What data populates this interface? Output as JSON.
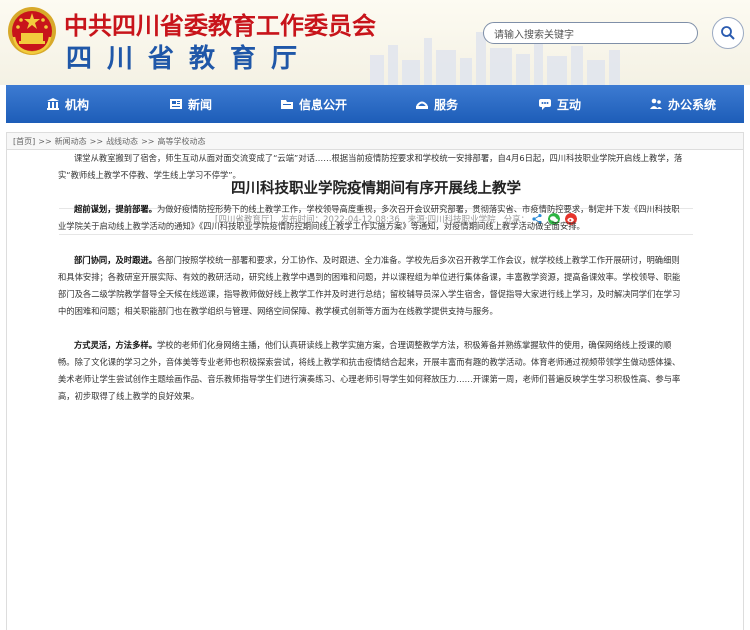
{
  "header": {
    "title": "中共四川省委教育工作委员会",
    "subtitle": "四川省教育厅",
    "search_placeholder": "请输入搜索关键字"
  },
  "nav": {
    "items": [
      {
        "label": "机构",
        "icon": "building-icon"
      },
      {
        "label": "新闻",
        "icon": "newspaper-icon"
      },
      {
        "label": "信息公开",
        "icon": "folder-icon"
      },
      {
        "label": "服务",
        "icon": "service-icon"
      },
      {
        "label": "互动",
        "icon": "chat-icon"
      },
      {
        "label": "办公系统",
        "icon": "people-icon"
      }
    ]
  },
  "breadcrumb": [
    "[首页]",
    ">>",
    "新闻动态",
    ">>",
    "战线动态",
    ">>",
    "高等学校动态"
  ],
  "article": {
    "title": "四川科技职业学院疫情期间有序开展线上教学",
    "meta": {
      "source_org": "[四川省教育厅]",
      "published": "发布时间：2022-04-12 08:36",
      "origin": "来源:四川科技职业学院",
      "share_label": "分享："
    },
    "paragraphs": [
      {
        "lead": "",
        "text": "课堂从教室搬到了宿舍，师生互动从面对面交流变成了“云端”对话……根据当前疫情防控要求和学校统一安排部署，自4月6日起，四川科技职业学院开启线上教学，落实“教师线上教学不停教、学生线上学习不停学”。"
      },
      {
        "lead": "超前谋划，提前部署。",
        "text": "为做好疫情防控形势下的线上教学工作，学校领导高度重视，多次召开会议研究部署，贯彻落实省、市疫情防控要求，制定并下发《四川科技职业学院关于启动线上教学活动的通知》《四川科技职业学院疫情防控期间线上教学工作实施方案》等通知，对疫情期间线上教学活动做全面安排。"
      },
      {
        "lead": "部门协同，及时跟进。",
        "text": "各部门按照学校统一部署和要求，分工协作、及时跟进、全力准备。学校先后多次召开教学工作会议，就学校线上教学工作开展研讨，明确细则和具体安排；各教研室开展实际、有效的教研活动，研究线上教学中遇到的困难和问题，并以课程组为单位进行集体备课，丰富教学资源，提高备课效率。学校领导、职能部门及各二级学院教学督导全天候在线巡课，指导教师做好线上教学工作并及时进行总结；留校辅导员深入学生宿舍，督促指导大家进行线上学习，及时解决同学们在学习中的困难和问题；相关职能部门也在教学组织与管理、网络空间保障、教学模式创新等方面为在线教学提供支持与服务。"
      },
      {
        "lead": "方式灵活，方法多样。",
        "text": "学校的老师们化身网络主播，他们认真研读线上教学实施方案，合理调整教学方法，积极筹备并熟练掌握软件的使用，确保网络线上授课的顺畅。除了文化课的学习之外，音体美等专业老师也积极探索尝试，将线上教学和抗击疫情结合起来，开展丰富而有趣的教学活动。体育老师通过视频带领学生做动感体操、美术老师让学生尝试创作主题绘画作品、音乐教师指导学生们进行演奏练习、心理老师引导学生如何释放压力……开课第一周，老师们普遍反映学生学习积极性高、参与率高，初步取得了线上教学的良好效果。"
      }
    ]
  },
  "colors": {
    "title_red": "#c8141b",
    "subtitle_blue": "#1f57a8",
    "nav_blue": "#2566bf"
  }
}
